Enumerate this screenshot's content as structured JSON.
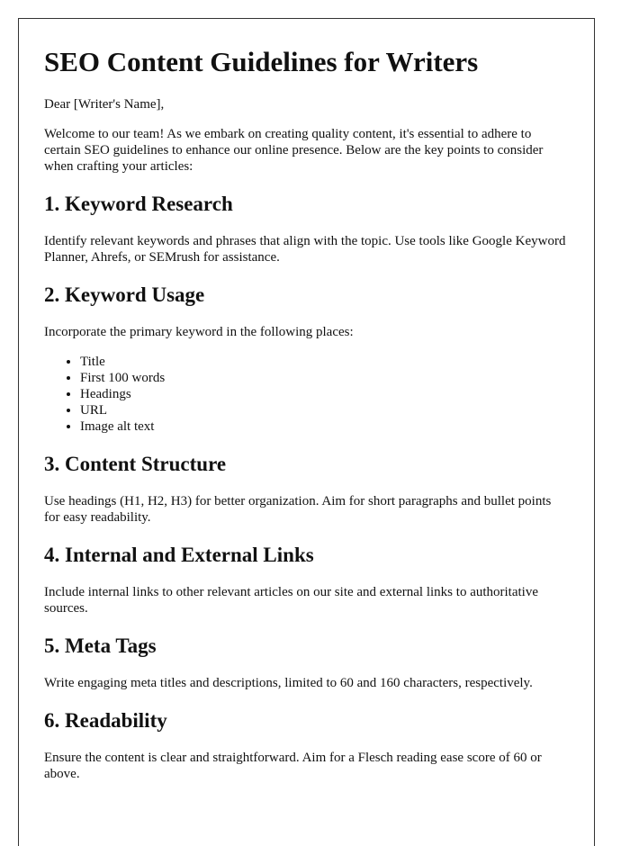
{
  "document": {
    "title": "SEO Content Guidelines for Writers",
    "salutation": "Dear [Writer's Name],",
    "intro": "Welcome to our team! As we embark on creating quality content, it's essential to adhere to certain SEO guidelines to enhance our online presence. Below are the key points to consider when crafting your articles:",
    "sections": [
      {
        "heading": "1. Keyword Research",
        "body": "Identify relevant keywords and phrases that align with the topic. Use tools like Google Keyword Planner, Ahrefs, or SEMrush for assistance."
      },
      {
        "heading": "2. Keyword Usage",
        "body": "Incorporate the primary keyword in the following places:",
        "list": [
          "Title",
          "First 100 words",
          "Headings",
          "URL",
          "Image alt text"
        ]
      },
      {
        "heading": "3. Content Structure",
        "body": "Use headings (H1, H2, H3) for better organization. Aim for short paragraphs and bullet points for easy readability."
      },
      {
        "heading": "4. Internal and External Links",
        "body": "Include internal links to other relevant articles on our site and external links to authoritative sources."
      },
      {
        "heading": "5. Meta Tags",
        "body": "Write engaging meta titles and descriptions, limited to 60 and 160 characters, respectively."
      },
      {
        "heading": "6. Readability",
        "body": "Ensure the content is clear and straightforward. Aim for a Flesch reading ease score of 60 or above."
      }
    ]
  }
}
